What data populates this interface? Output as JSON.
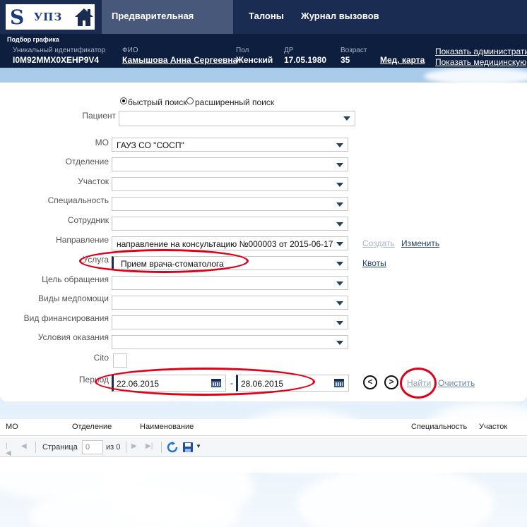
{
  "app": {
    "logo_text": "УПЗ"
  },
  "nav": {
    "tabs": [
      "Предварительная запись",
      "Талоны",
      "Журнал вызовов"
    ],
    "active_tab": "Предварительная запись"
  },
  "patient_bar": {
    "title": "Подбор графика",
    "fields": [
      {
        "label": "Уникальный идентификатор",
        "value": "I0M92MMX0XEHP9V4"
      },
      {
        "label": "ФИО",
        "value": "Камышова Анна Сергеевна"
      },
      {
        "label": "Пол",
        "value": "Женский"
      },
      {
        "label": "ДР",
        "value": "17.05.1980"
      },
      {
        "label": "Возраст",
        "value": "35"
      }
    ],
    "med_card_link": "Мед. карта",
    "show_admin_link": "Показать административ",
    "show_medical_link": "Показать медицинскую"
  },
  "form": {
    "search_mode": {
      "quick": "быстрый поиск",
      "extended": "расширенный поиск",
      "selected": "quick"
    },
    "fields": {
      "patient": {
        "label": "Пациент",
        "value": ""
      },
      "mo": {
        "label": "МО",
        "value": "ГАУЗ СО \"СОСП\""
      },
      "department": {
        "label": "Отделение",
        "value": ""
      },
      "district": {
        "label": "Участок",
        "value": ""
      },
      "specialty": {
        "label": "Специальность",
        "value": ""
      },
      "employee": {
        "label": "Сотрудник",
        "value": ""
      },
      "referral": {
        "label": "Направление",
        "value": "направление на консультацию №000003 от 2015-06-17"
      },
      "service": {
        "label": "Услуга",
        "value": "Прием врача-стоматолога"
      },
      "visit_goal": {
        "label": "Цель обращения",
        "value": ""
      },
      "care_type": {
        "label": "Виды медпомощи",
        "value": ""
      },
      "funding": {
        "label": "Вид финансирования",
        "value": ""
      },
      "conditions": {
        "label": "Условия оказания",
        "value": ""
      },
      "cito": {
        "label": "Cito",
        "checked": false
      },
      "period": {
        "label": "Период",
        "from": "22.06.2015",
        "separator": "-",
        "to": "28.06.2015"
      }
    },
    "links": {
      "create": "Создать",
      "edit": "Изменить",
      "quotas": "Квоты"
    },
    "buttons": {
      "prev": "<",
      "next": ">",
      "find": "Найти",
      "clear": "Очистить"
    },
    "highlight_color": "#e0001a"
  },
  "grid": {
    "columns": [
      "МО",
      "Отделение",
      "Наименование",
      "Специальность",
      "Участок"
    ],
    "pager": {
      "page_label": "Страница",
      "page_value": "0",
      "of_label": "из 0"
    }
  }
}
